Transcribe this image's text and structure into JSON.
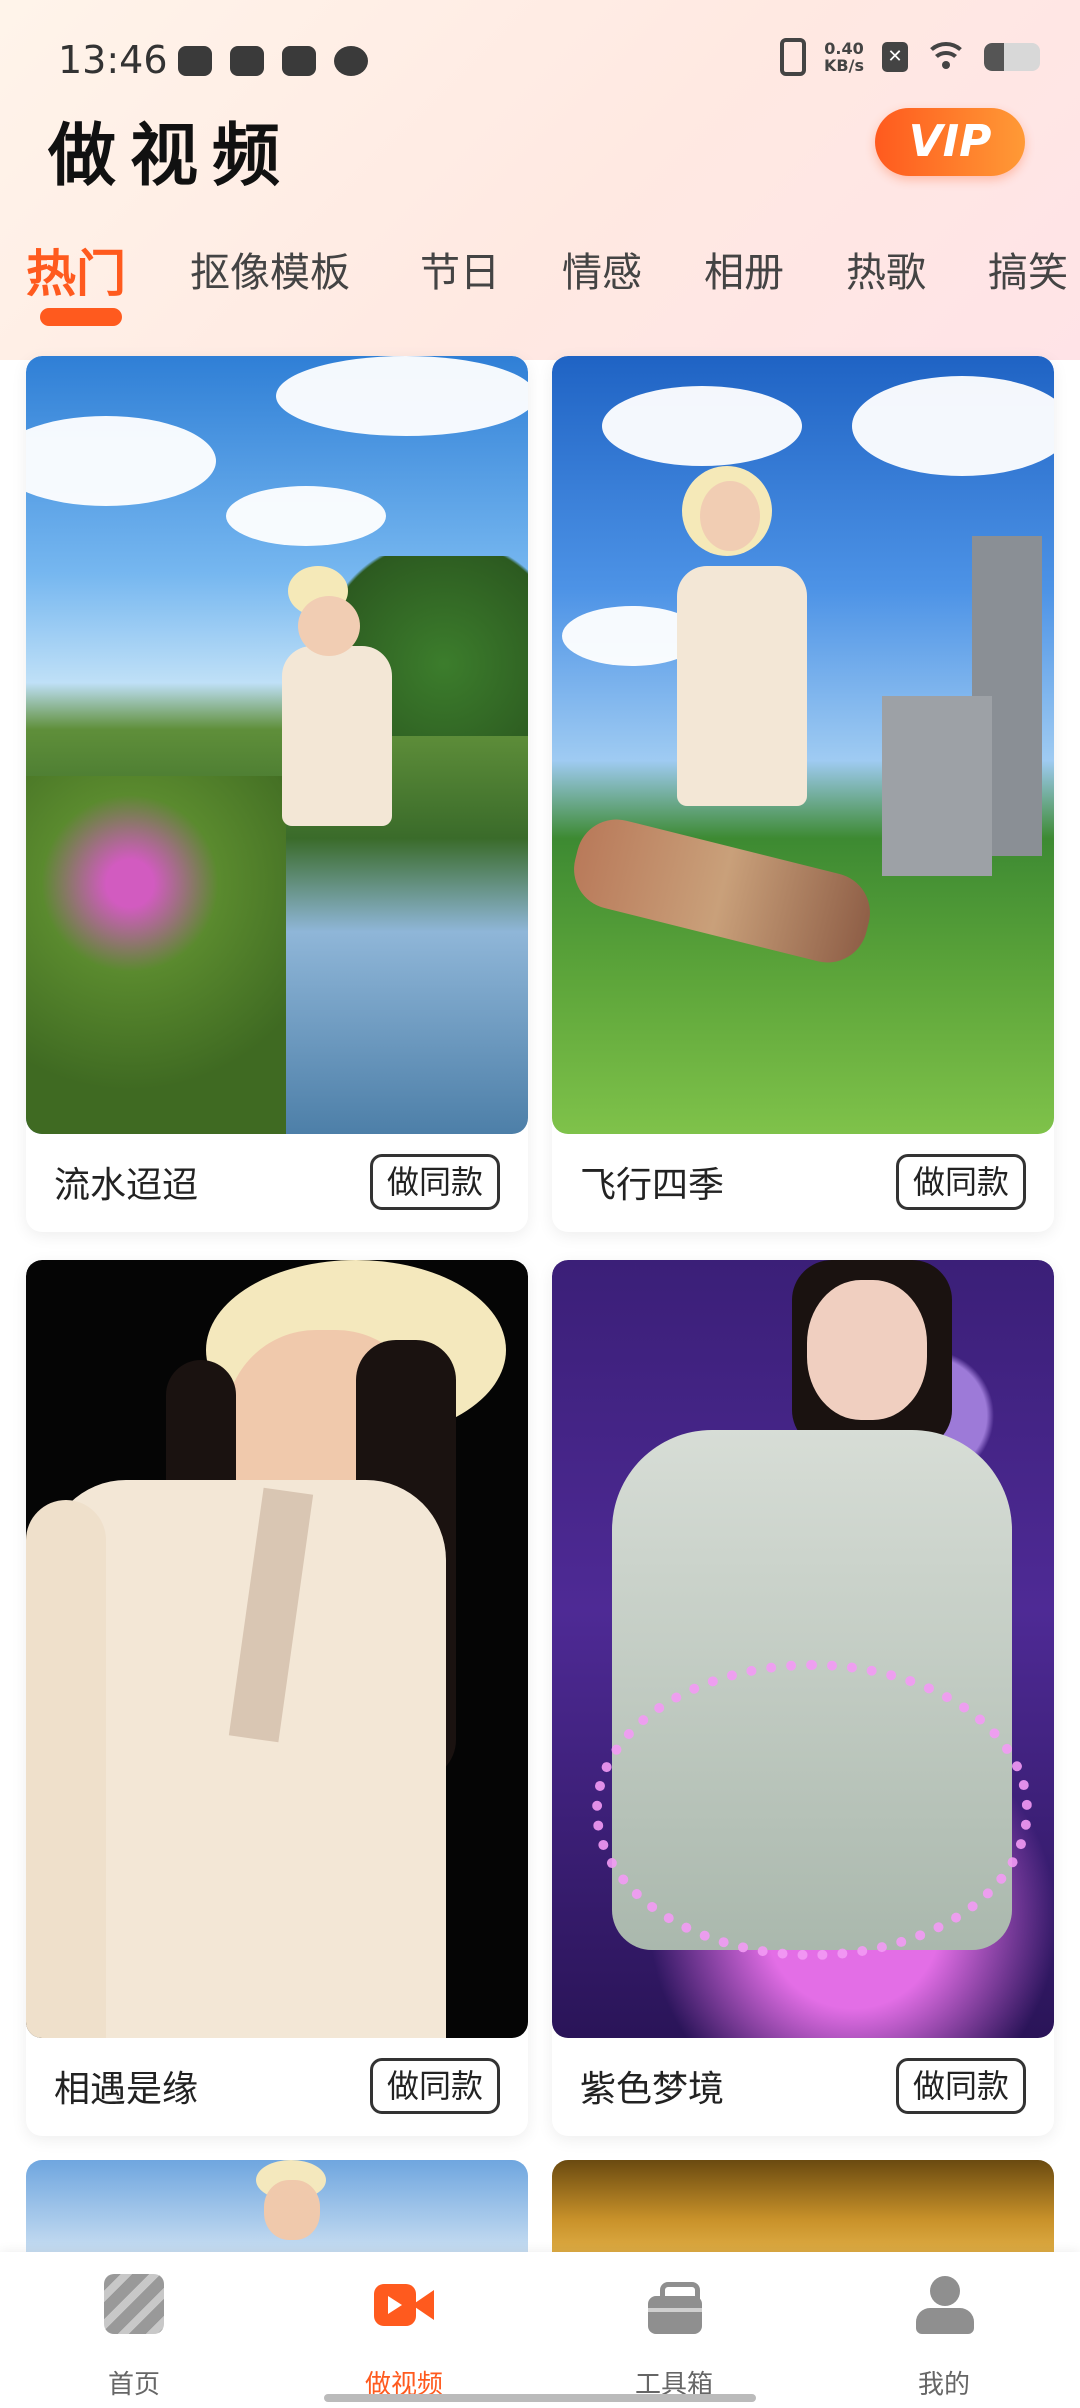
{
  "status": {
    "time": "13:46",
    "net_speed_value": "0.40",
    "net_speed_unit": "KB/s",
    "battery_level": 0.35
  },
  "header": {
    "title": "做视频",
    "vip_label": "VIP"
  },
  "tabs": [
    "热门",
    "抠像模板",
    "节日",
    "情感",
    "相册",
    "热歌",
    "搞笑"
  ],
  "active_tab": "热门",
  "cards": [
    {
      "title": "流水迢迢",
      "button": "做同款"
    },
    {
      "title": "飞行四季",
      "button": "做同款"
    },
    {
      "title": "相遇是缘",
      "button": "做同款"
    },
    {
      "title": "紫色梦境",
      "button": "做同款"
    }
  ],
  "bottom_nav": [
    {
      "label": "首页",
      "icon": "home-icon"
    },
    {
      "label": "做视频",
      "icon": "video-camera-icon"
    },
    {
      "label": "工具箱",
      "icon": "toolbox-icon"
    },
    {
      "label": "我的",
      "icon": "profile-icon"
    }
  ],
  "colors": {
    "accent": "#ff5a1e",
    "vip_gradient_start": "#ff5a1e",
    "vip_gradient_end": "#ff9a36",
    "nav_inactive": "#888888"
  }
}
